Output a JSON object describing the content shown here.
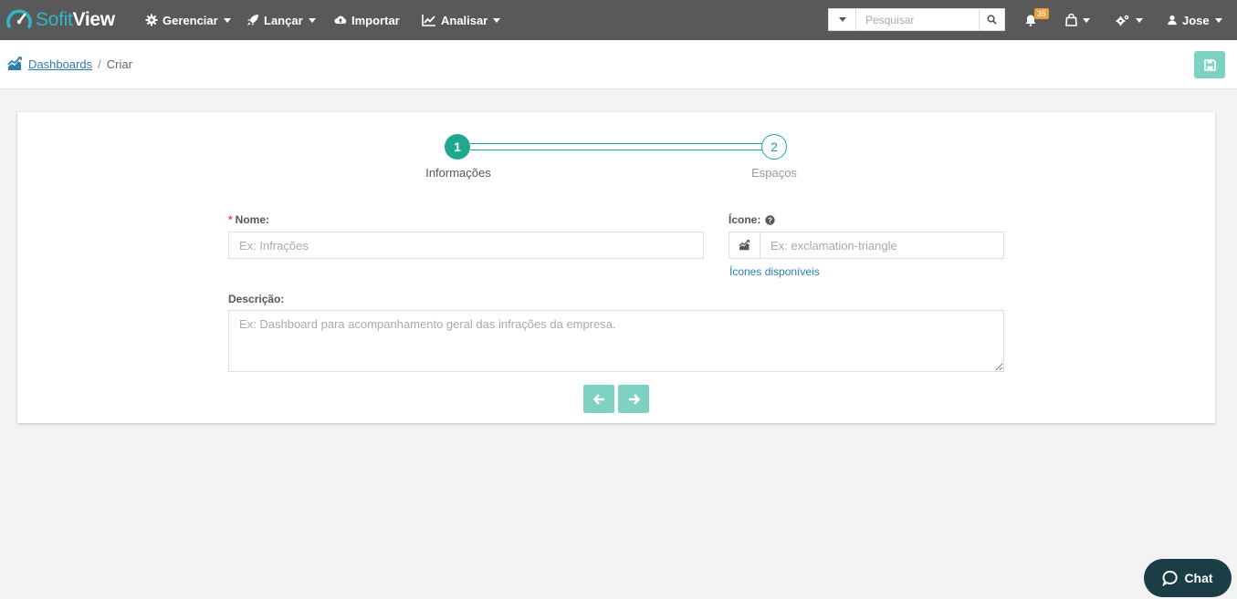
{
  "brand": {
    "part1": "Sofit",
    "part2": "View"
  },
  "nav": {
    "manage": "Gerenciar",
    "launch": "Lançar",
    "import": "Importar",
    "analyze": "Analisar"
  },
  "search": {
    "placeholder": "Pesquisar"
  },
  "notifications": {
    "count": "35"
  },
  "user": {
    "name": "Jose"
  },
  "breadcrumb": {
    "parent": "Dashboards",
    "separator": "/",
    "current": "Criar"
  },
  "wizard": {
    "steps": [
      {
        "number": "1",
        "label": "Informações"
      },
      {
        "number": "2",
        "label": "Espaços"
      }
    ]
  },
  "form": {
    "name_required_mark": "*",
    "name_label": "Nome:",
    "name_placeholder": "Ex: Infrações",
    "icon_label": "Ícone:",
    "icon_placeholder": "Ex: exclamation-triangle",
    "icons_available_link": "Ícones disponíveis",
    "description_label": "Descrição:",
    "description_placeholder": "Ex: Dashboard para acompanhamento geral das infrações da empresa."
  },
  "chat": {
    "label": "Chat"
  },
  "colors": {
    "topbar": "#595959",
    "accent": "#1fa88f",
    "button": "#7fd1c4",
    "link": "#2a7fad",
    "chat": "#1b3e46",
    "badge": "#e8a13c"
  }
}
